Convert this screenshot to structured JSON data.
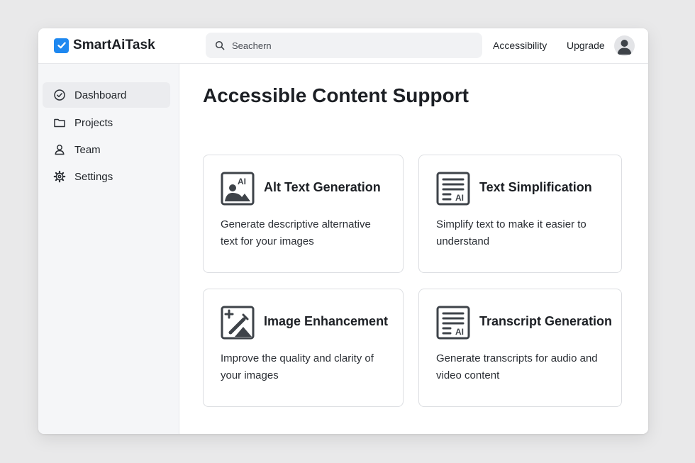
{
  "app": {
    "name": "SmartAiTask",
    "brand_color": "#1e88f0"
  },
  "header": {
    "search": {
      "placeholder": "Seachern",
      "value": ""
    },
    "links": {
      "accessibility": "Accessibility",
      "upgrade": "Upgrade"
    }
  },
  "sidebar": {
    "items": [
      {
        "label": "Dashboard",
        "icon": "check-circle-icon",
        "active": true
      },
      {
        "label": "Projects",
        "icon": "folder-icon",
        "active": false
      },
      {
        "label": "Team",
        "icon": "user-icon",
        "active": false
      },
      {
        "label": "Settings",
        "icon": "gear-icon",
        "active": false
      }
    ]
  },
  "main": {
    "title": "Accessible Content Support",
    "cards": [
      {
        "title": "Alt Text Generation",
        "icon": "ai-image-icon",
        "icon_text": "AI",
        "description": "Generate descriptive alternative text for your images"
      },
      {
        "title": "Text Simplification",
        "icon": "ai-document-icon",
        "icon_text": "AI",
        "description": "Simplify text to make it easier to understand"
      },
      {
        "title": "Image Enhancement",
        "icon": "magic-wand-image-icon",
        "description": "Improve the quality and clarity of your images"
      },
      {
        "title": "Transcript Generation",
        "icon": "ai-transcript-icon",
        "icon_text": "AI",
        "description": "Generate transcripts for audio and video content"
      }
    ]
  }
}
